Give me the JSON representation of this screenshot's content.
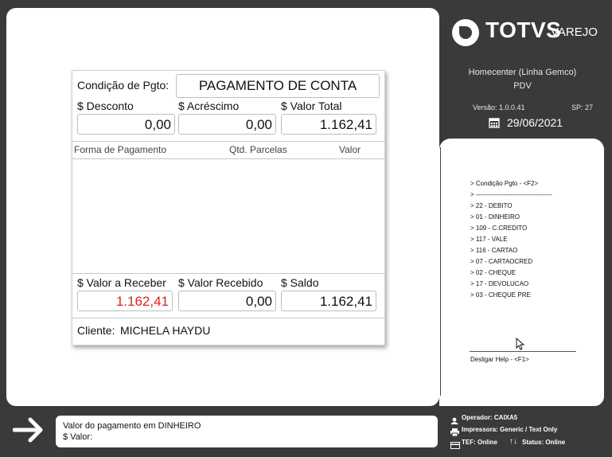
{
  "payment": {
    "condicao_label": "Condição de Pgto:",
    "condicao_value": "PAGAMENTO DE CONTA",
    "desconto_label": "$ Desconto",
    "desconto_value": "0,00",
    "acrescimo_label": "$ Acréscimo",
    "acrescimo_value": "0,00",
    "valor_total_label": "$ Valor Total",
    "valor_total_value": "1.162,41",
    "table_headers": [
      "Forma de Pagamento",
      "Qtd. Parcelas",
      "Valor"
    ],
    "valor_receber_label": "$ Valor a Receber",
    "valor_receber_value": "1.162,41",
    "valor_recebido_label": "$ Valor Recebido",
    "valor_recebido_value": "0,00",
    "saldo_label": "$ Saldo",
    "saldo_value": "1.162,41",
    "cliente_label": "Cliente:",
    "cliente_value": "MICHELA HAYDU"
  },
  "brand": {
    "logo": "TOTVS",
    "logo_sub": "VAREJO",
    "store": "Homecenter (Linha Gemco)",
    "pdv": "PDV",
    "versao": "Versão: 1.0.0.41",
    "sp": "SP: 27",
    "date": "29/06/2021"
  },
  "help": {
    "items": [
      "> Condição Pgto - <F2>",
      ">  ------------------------------------",
      "> 22 - DEBITO",
      "> 01 - DINHEIRO",
      "> 109 - C.CREDITO",
      "> 117 - VALE",
      "> 116 - CARTAO",
      "> 07 - CARTAOCRED",
      "> 02 - CHEQUE",
      "> 17 - DEVOLUCAO",
      "> 03 - CHEQUE PRE"
    ],
    "footer": "Desligar Help - <F1>"
  },
  "bottom": {
    "message_line1": "Valor do pagamento em DINHEIRO",
    "message_line2": "$ Valor:",
    "operador": "Operador: CAIXA5",
    "impressora": "Impressora: Generic / Text Only",
    "tef": "TEF: Online",
    "status": "Status: Online"
  },
  "colors": {
    "background": "#3a3a3a",
    "accent_red": "#e0201c"
  }
}
